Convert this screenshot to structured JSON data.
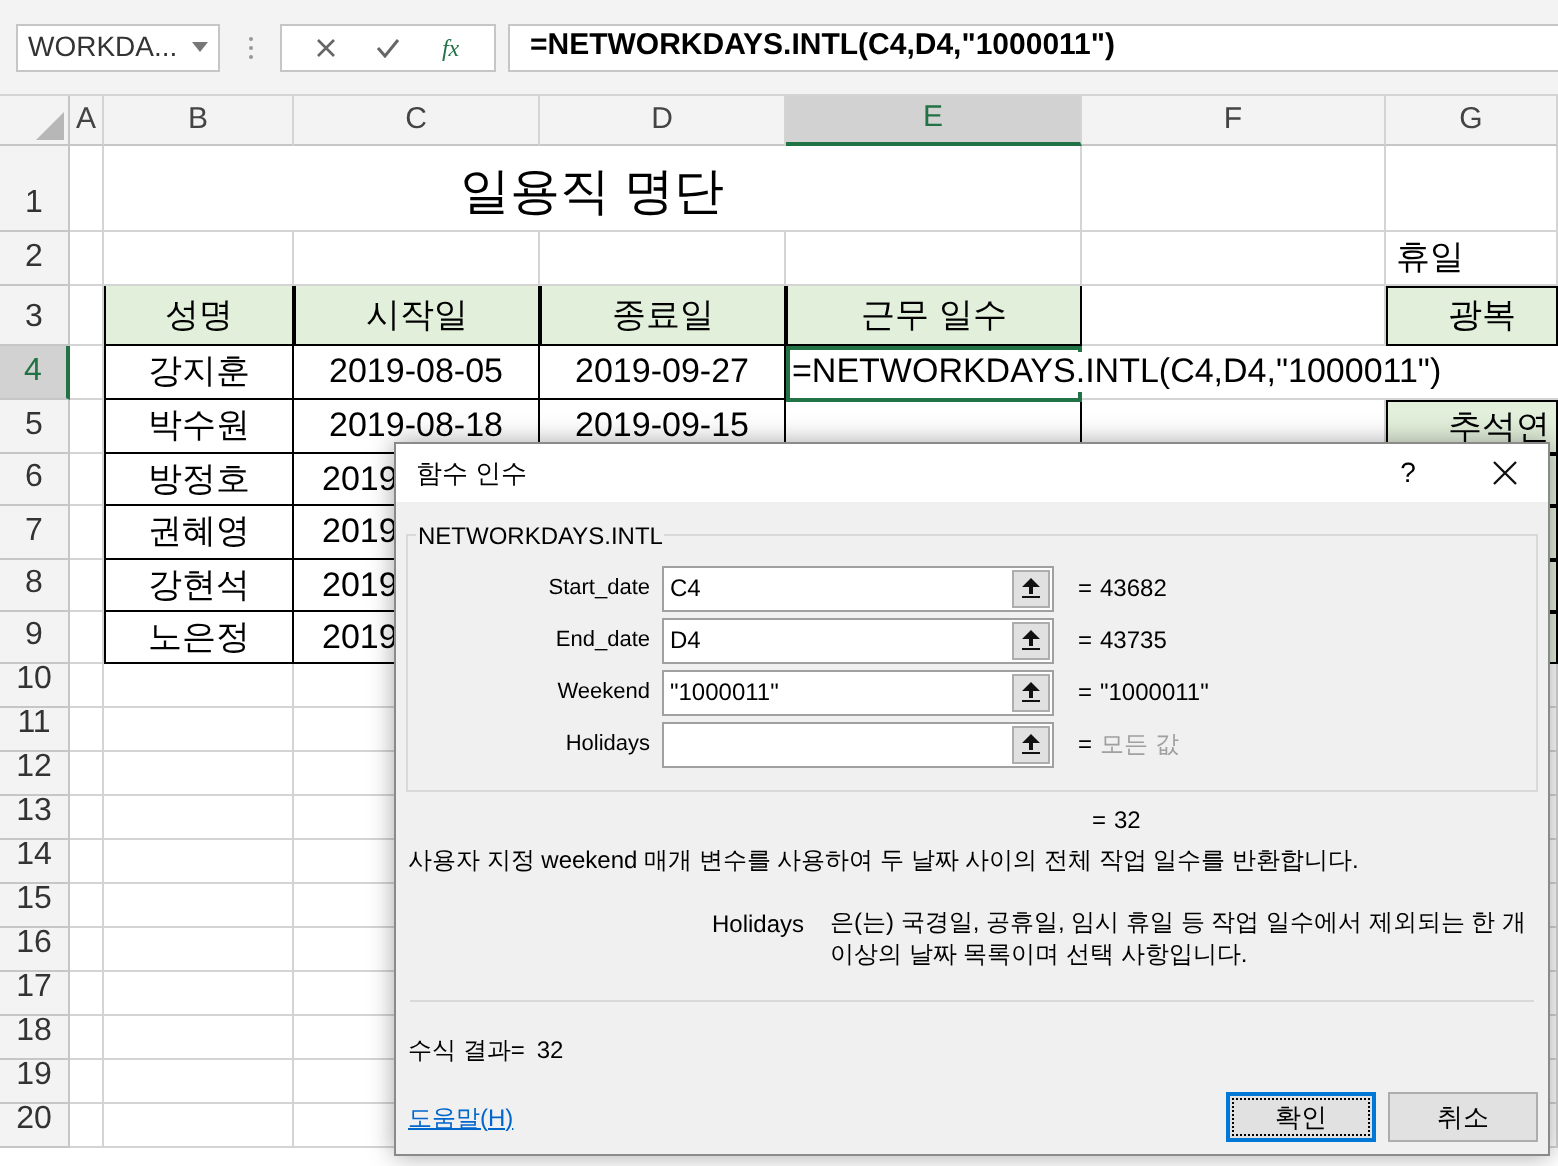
{
  "name_box": {
    "value": "WORKDA..."
  },
  "formula_bar": {
    "fx_label": "fx",
    "value": "=NETWORKDAYS.INTL(C4,D4,\"1000011\")"
  },
  "columns": [
    {
      "label": "A",
      "selected": false
    },
    {
      "label": "B",
      "selected": false
    },
    {
      "label": "C",
      "selected": false
    },
    {
      "label": "D",
      "selected": false
    },
    {
      "label": "E",
      "selected": true
    },
    {
      "label": "F",
      "selected": false
    },
    {
      "label": "G",
      "selected": false
    }
  ],
  "row_headers": [
    {
      "label": "1",
      "selected": false
    },
    {
      "label": "2",
      "selected": false
    },
    {
      "label": "3",
      "selected": false
    },
    {
      "label": "4",
      "selected": true
    },
    {
      "label": "5",
      "selected": false
    },
    {
      "label": "6",
      "selected": false
    },
    {
      "label": "7",
      "selected": false
    },
    {
      "label": "8",
      "selected": false
    },
    {
      "label": "9",
      "selected": false
    },
    {
      "label": "10",
      "selected": false
    },
    {
      "label": "11",
      "selected": false
    },
    {
      "label": "12",
      "selected": false
    },
    {
      "label": "13",
      "selected": false
    },
    {
      "label": "14",
      "selected": false
    },
    {
      "label": "15",
      "selected": false
    },
    {
      "label": "16",
      "selected": false
    },
    {
      "label": "17",
      "selected": false
    },
    {
      "label": "18",
      "selected": false
    },
    {
      "label": "19",
      "selected": false
    },
    {
      "label": "20",
      "selected": false
    }
  ],
  "sheet": {
    "title": "일용직 명단",
    "holiday_label": "휴일",
    "table_headers": [
      "성명",
      "시작일",
      "종료일",
      "근무 일수"
    ],
    "people": [
      {
        "name": "강지훈",
        "start": "2019-08-05",
        "end": "2019-09-27"
      },
      {
        "name": "박수원",
        "start": "2019-08-18",
        "end": "2019-09-15"
      },
      {
        "name": "방정호",
        "start": "2019"
      },
      {
        "name": "권혜영",
        "start": "2019"
      },
      {
        "name": "강현석",
        "start": "2019"
      },
      {
        "name": "노은정",
        "start": "2019"
      }
    ],
    "active_cell": {
      "formula": "=NETWORKDAYS.INTL(C4,D4,\"1000011\")"
    },
    "holidays": [
      "광복",
      "추석연"
    ]
  },
  "dialog": {
    "title": "함수 인수",
    "help_glyph": "?",
    "group_title": "NETWORKDAYS.INTL",
    "arguments": [
      {
        "label": "Start_date",
        "value": "C4",
        "sign": "=",
        "result": "43682",
        "muted": false
      },
      {
        "label": "End_date",
        "value": "D4",
        "sign": "=",
        "result": "43735",
        "muted": false
      },
      {
        "label": "Weekend",
        "value": "\"1000011\"",
        "sign": "=",
        "result": "\"1000011\"",
        "muted": false
      },
      {
        "label": "Holidays",
        "sign": "=",
        "result": "모든 값",
        "muted": true
      }
    ],
    "total": {
      "sign": "=",
      "value": "32"
    },
    "description": "사용자 지정 weekend 매개 변수를 사용하여 두 날짜 사이의 전체 작업 일수를 반환합니다.",
    "argument_help": {
      "label": "Holidays",
      "text": "은(는) 국경일, 공휴일, 임시 휴일 등 작업 일수에서 제외되는 한 개 이상의 날짜 목록이며 선택 사항입니다."
    },
    "formula_result": {
      "label": "수식 결과=",
      "value": "32"
    },
    "help_link": "도움말(H)",
    "buttons": [
      {
        "label": "확인",
        "selected": true
      },
      {
        "label": "취소",
        "selected": false
      }
    ]
  }
}
